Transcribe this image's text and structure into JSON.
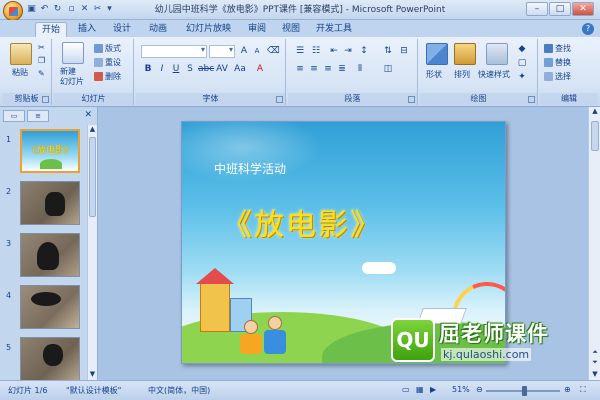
{
  "window": {
    "title": "幼儿园中班科学《放电影》PPT课件 [兼容模式] - Microsoft PowerPoint",
    "controls": {
      "minimize": "–",
      "maximize": "□",
      "close": "✕"
    }
  },
  "tabs": [
    {
      "label": "开始",
      "active": true
    },
    {
      "label": "插入"
    },
    {
      "label": "设计"
    },
    {
      "label": "动画"
    },
    {
      "label": "幻灯片放映"
    },
    {
      "label": "审阅"
    },
    {
      "label": "视图"
    },
    {
      "label": "开发工具"
    }
  ],
  "help_label": "?",
  "ribbon": {
    "clipboard": {
      "paste_label": "粘贴",
      "group_label": "剪贴板"
    },
    "slides": {
      "new_slide_label": "新建\n幻灯片",
      "layout_label": "版式",
      "reset_label": "重设",
      "delete_label": "删除",
      "group_label": "幻灯片"
    },
    "font": {
      "group_label": "字体"
    },
    "paragraph": {
      "group_label": "段落"
    },
    "drawing": {
      "shapes_label": "形状",
      "arrange_label": "排列",
      "quick_styles_label": "快速样式",
      "group_label": "绘图"
    },
    "editing": {
      "find_label": "查找",
      "replace_label": "替换",
      "select_label": "选择",
      "group_label": "编辑"
    }
  },
  "thumbnails": [
    {
      "number": "1",
      "title": "《放电影》",
      "selected": true
    },
    {
      "number": "2"
    },
    {
      "number": "3"
    },
    {
      "number": "4"
    },
    {
      "number": "5"
    }
  ],
  "slide": {
    "subtitle": "中班科学活动",
    "title": "《放电影》"
  },
  "watermark": {
    "logo": "QU",
    "text": "屈老师课件",
    "url": "kj.qulaoshi.com"
  },
  "statusbar": {
    "slide_indicator": "幻灯片 1/6",
    "theme": "\"默认设计模板\"",
    "language": "中文(简体，中国)",
    "zoom": "51%",
    "zoom_fraction": 0.51
  },
  "colors": {
    "accent": "#15428b",
    "title_yellow": "#ffe014",
    "selection": "#f0a030"
  }
}
